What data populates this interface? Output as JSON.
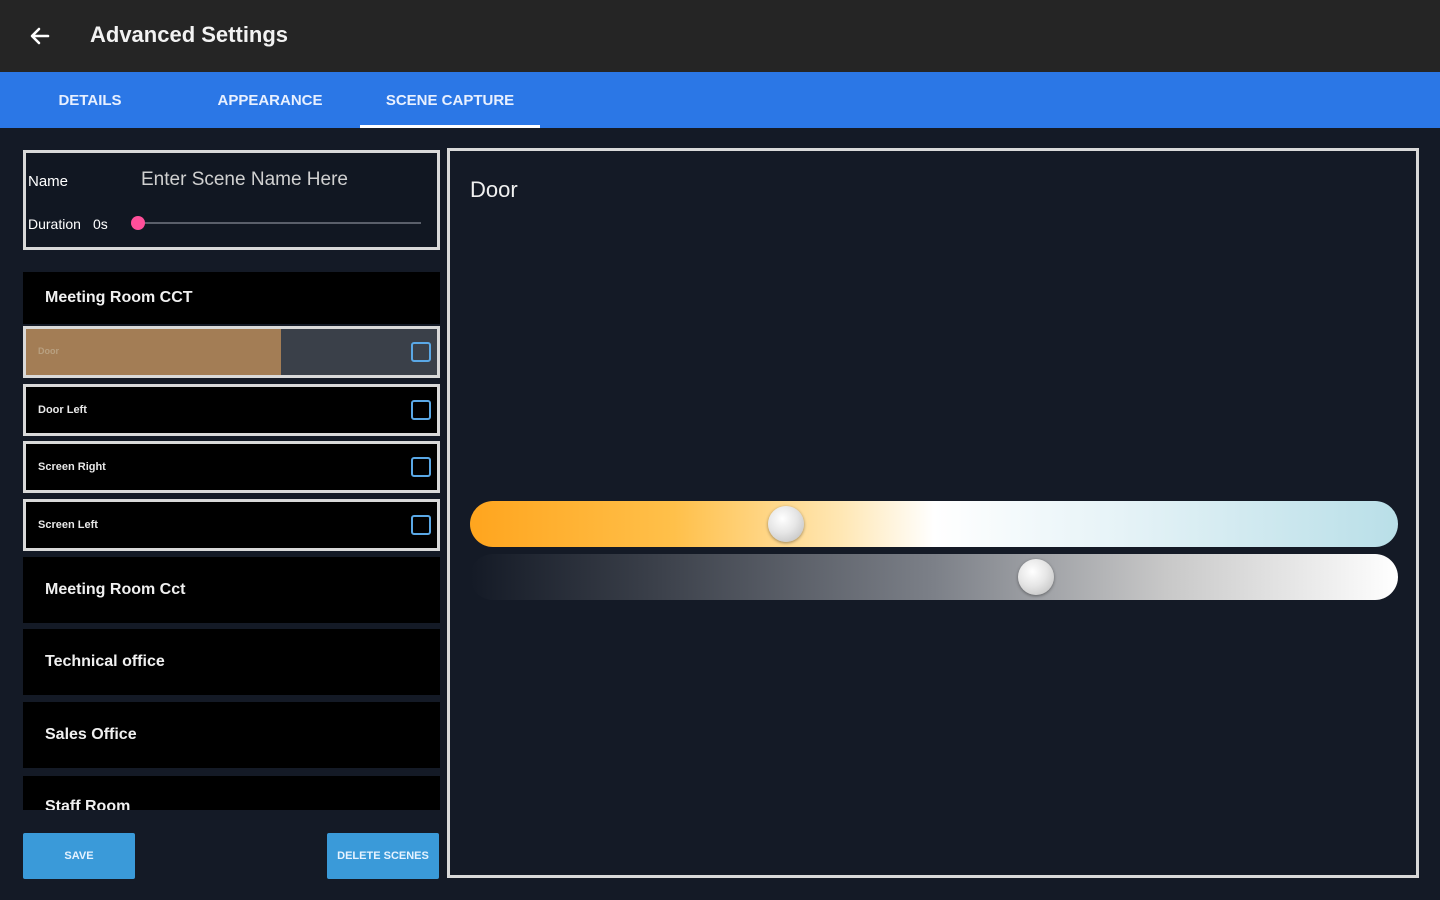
{
  "header": {
    "title": "Advanced Settings",
    "back_icon": "arrow-left-icon"
  },
  "tabs": [
    {
      "label": "DETAILS",
      "active": false
    },
    {
      "label": "APPEARANCE",
      "active": false
    },
    {
      "label": "SCENE CAPTURE",
      "active": true
    }
  ],
  "scene_form": {
    "name_label": "Name",
    "name_placeholder": "Enter Scene Name Here",
    "duration_label": "Duration",
    "duration_value": "0s",
    "duration_slider_value": 0
  },
  "groups": [
    {
      "name": "Meeting Room CCT",
      "lights": [
        {
          "label": "Door",
          "checked": false,
          "level": 0.62,
          "selected": true
        },
        {
          "label": "Door Left",
          "checked": false
        },
        {
          "label": "Screen Right",
          "checked": false
        },
        {
          "label": "Screen Left",
          "checked": false
        }
      ]
    },
    {
      "name": "Meeting Room Cct"
    },
    {
      "name": "Technical office"
    },
    {
      "name": "Sales Office"
    },
    {
      "name": "Staff Room"
    }
  ],
  "buttons": {
    "save": "SAVE",
    "delete_scenes": "DELETE SCENES"
  },
  "detail": {
    "title": "Door",
    "cct_slider_value": 0.34,
    "brightness_slider_value": 0.61
  },
  "colors": {
    "topbar": "#252525",
    "tabbar": "#2b77e6",
    "background": "#141a26",
    "button": "#3a9ad9",
    "duration_thumb": "#ff4f9a",
    "level_fill": "#a37d55"
  }
}
